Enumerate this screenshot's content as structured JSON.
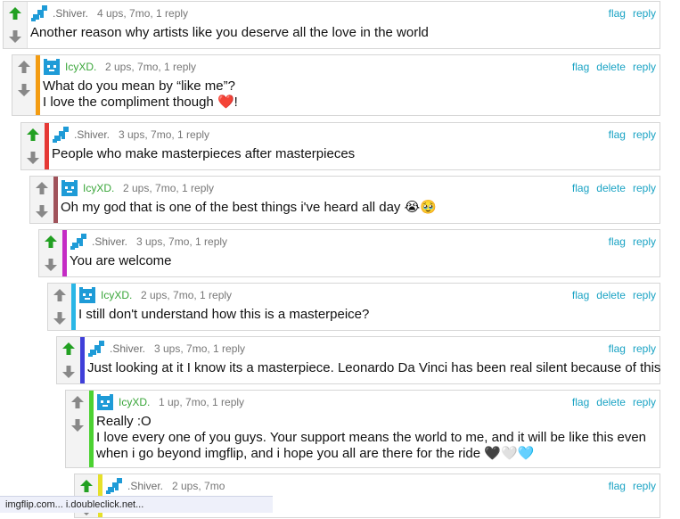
{
  "colors": {
    "accent_link": "#1aa3c4",
    "upvote_active": "#22a022",
    "vote_inactive": "#888888"
  },
  "comments": [
    {
      "user": ".Shiver.",
      "stats": "4 ups, 7mo, 1 reply",
      "actions": [
        "flag",
        "reply"
      ],
      "lines": [
        "Another reason why artists like you deserve all the love in the world"
      ],
      "stripe_color": "",
      "upvoted": true
    },
    {
      "user": "IcyXD.",
      "stats": "2 ups, 7mo, 1 reply",
      "actions": [
        "flag",
        "delete",
        "reply"
      ],
      "lines": [
        "What do you mean by “like me”?",
        "I love the compliment though ❤️!"
      ],
      "stripe_color": "#f39c12",
      "upvoted": false
    },
    {
      "user": ".Shiver.",
      "stats": "3 ups, 7mo, 1 reply",
      "actions": [
        "flag",
        "reply"
      ],
      "lines": [
        "People who make masterpieces after masterpieces"
      ],
      "stripe_color": "#e53935",
      "upvoted": true
    },
    {
      "user": "IcyXD.",
      "stats": "2 ups, 7mo, 1 reply",
      "actions": [
        "flag",
        "delete",
        "reply"
      ],
      "lines": [
        "Oh my god that is one of the best things i've heard all day 😭🥹"
      ],
      "stripe_color": "#a0525a",
      "upvoted": false
    },
    {
      "user": ".Shiver.",
      "stats": "3 ups, 7mo, 1 reply",
      "actions": [
        "flag",
        "reply"
      ],
      "lines": [
        "You are welcome"
      ],
      "stripe_color": "#c42bc4",
      "upvoted": true
    },
    {
      "user": "IcyXD.",
      "stats": "2 ups, 7mo, 1 reply",
      "actions": [
        "flag",
        "delete",
        "reply"
      ],
      "lines": [
        "I still don't understand how this is a masterpeice?"
      ],
      "stripe_color": "#29b6e6",
      "upvoted": false
    },
    {
      "user": ".Shiver.",
      "stats": "3 ups, 7mo, 1 reply",
      "actions": [
        "flag",
        "reply"
      ],
      "lines": [
        "Just looking at it I know its a masterpiece. Leonardo Da Vinci has been real silent because of this"
      ],
      "stripe_color": "#3f3fd9",
      "upvoted": true
    },
    {
      "user": "IcyXD.",
      "stats": "1 up, 7mo, 1 reply",
      "actions": [
        "flag",
        "delete",
        "reply"
      ],
      "lines": [
        "Really :O",
        "I love every one of you guys. Your support means the world to me, and it will be like this even",
        "when i go beyond imgflip, and i hope you all are there for the ride 🖤🤍🩵"
      ],
      "stripe_color": "#4cd232",
      "upvoted": false
    },
    {
      "user": ".Shiver.",
      "stats": "2 ups, 7mo",
      "actions": [
        "flag",
        "reply"
      ],
      "lines": [],
      "stripe_color": "#e6e02a",
      "upvoted": true
    }
  ],
  "status_bar": {
    "text": "imgflip.com... i.doubleclick.net..."
  }
}
